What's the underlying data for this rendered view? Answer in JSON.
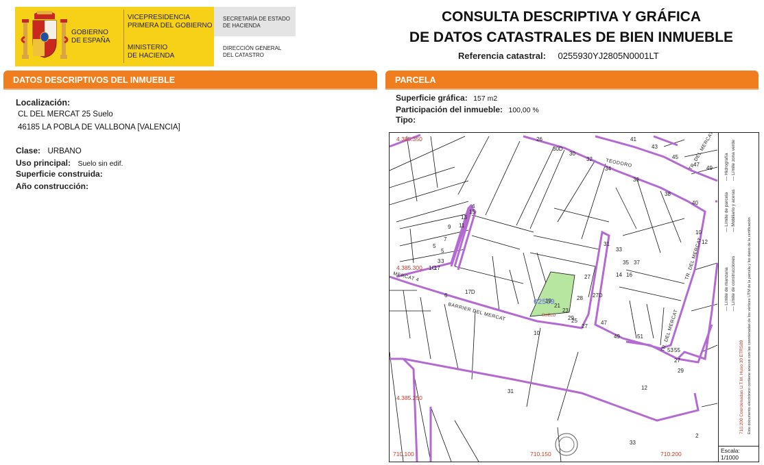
{
  "header": {
    "gobierno": "GOBIERNO\nDE ESPAÑA",
    "vicepresidencia": "VICEPRESIDENCIA\nPRIMERA DEL GOBIERNO",
    "ministerio": "MINISTERIO\nDE HACIENDA",
    "secretaria": "SECRETARÍA DE ESTADO\nDE HACIENDA",
    "direccion": "DIRECCIÓN GENERAL\nDEL CATASTRO",
    "title_line1": "CONSULTA DESCRIPTIVA Y GRÁFICA",
    "title_line2": "DE DATOS CATASTRALES DE BIEN INMUEBLE",
    "ref_label": "Referencia catastral:",
    "ref_value": "0255930YJ2805N0001LT"
  },
  "left_section": {
    "title": "DATOS DESCRIPTIVOS DEL INMUEBLE",
    "localizacion_label": "Localización:",
    "address_line1": "CL DEL MERCAT 25 Suelo",
    "address_line2": "46185 LA POBLA DE VALLBONA [VALENCIA]",
    "clase_label": "Clase:",
    "clase_value": "URBANO",
    "uso_label": "Uso principal:",
    "uso_value": "Suelo sin edif.",
    "superficie_label": "Superficie construida:",
    "anio_label": "Año construcción:"
  },
  "right_section": {
    "title": "PARCELA",
    "superficie_label": "Superficie gráfica:",
    "superficie_value": "157 m2",
    "participacion_label": "Participación del inmueble:",
    "participacion_value": "100,00 %",
    "tipo_label": "Tipo:"
  },
  "map": {
    "coords": {
      "y1": "4.385.350",
      "y2": "4.385.300",
      "y3": "4.385.250",
      "x1": "710.100",
      "x2": "710.150",
      "x3": "710.200"
    },
    "parcel_id": "02559",
    "parcel_sub": "SUELO",
    "streets": {
      "teodoro": "TEODORO",
      "mercat_a": "MERCAT 4",
      "mercat_b": "BARRIER DEL MERCAT",
      "mercat_c": "TR. DEL MERCAT",
      "mercat_d": "TR. DEL MERCAT",
      "mercat_e": "TR. DEL MERCAT"
    },
    "numbers": [
      "26",
      "30D",
      "30",
      "32",
      "34",
      "36",
      "38",
      "40",
      "41",
      "43",
      "45",
      "47",
      "49",
      "10",
      "12",
      "31",
      "33",
      "35",
      "37",
      "27",
      "28",
      "29",
      "27D",
      "47",
      "49",
      "51",
      "53",
      "55",
      "19",
      "21",
      "23",
      "25",
      "27",
      "17D",
      "6",
      "10",
      "31",
      "12",
      "2",
      "33",
      "29",
      "27",
      "17",
      "14",
      "16",
      "3",
      "5",
      "7",
      "9",
      "11",
      "13",
      "15",
      "4",
      "1C",
      "3",
      "5"
    ],
    "color_parcel": "#b7e6a0",
    "color_block": "#b36ad1"
  },
  "legend": {
    "items": [
      "Límite de manzana",
      "Límite de parcela",
      "Límite de construcciones",
      "Mobiliario y aceras",
      "Límite zona verde",
      "Hidrografía"
    ],
    "coord_note": "710.200 Coordenadas U.T.M. Huso 30 ETRS89",
    "doc_note": "Este documento electrónico contiene anexos con las coordenadas de los vértices UTM de la parcela y los datos de la certificación",
    "scale_label": "Escala:",
    "scale_value": "1/1000"
  }
}
